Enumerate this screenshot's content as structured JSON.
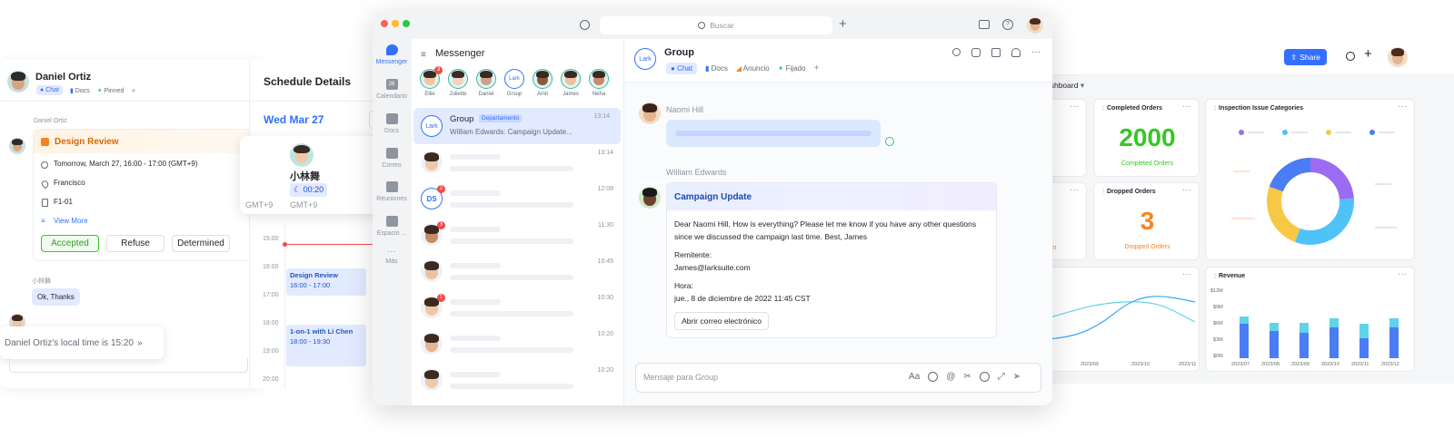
{
  "left_panel": {
    "user_name": "Daniel Ortiz",
    "tabs": [
      "Chat",
      "Docs",
      "Pinned"
    ],
    "plus": "+",
    "sender": "Daniel Ortiz",
    "event_title": "Design Review",
    "event_time": "Tomorrow, March 27, 16:00 - 17:00 (GMT+9)",
    "event_location": "Francisco",
    "event_room": "F1-01",
    "view_more": "View More",
    "rsvp": [
      "Accepted",
      "Refuse",
      "Determined"
    ],
    "reply_sender": "小林舞",
    "reply_text": "Ok, Thanks",
    "local_time": "Daniel Ortiz's local time is 15:20",
    "local_time_chevron": "»"
  },
  "schedule": {
    "title": "Schedule Details",
    "date": "Wed Mar 27",
    "popup_name": "小林舞",
    "popup_time": "00:20",
    "popup_tz": "GMT+9",
    "tz": "GMT+9",
    "hours": [
      "15:00",
      "16:00",
      "17:00",
      "18:00",
      "19:00",
      "20:00"
    ],
    "events": [
      {
        "title": "Design Review",
        "time": "16:00 - 17:00"
      },
      {
        "title": "1-on-1 with Li Chen",
        "time": "18:00 - 19:30"
      }
    ]
  },
  "window": {
    "search_placeholder": "Buscar",
    "plus": "+"
  },
  "rail": {
    "items": [
      "Messenger",
      "Calendario",
      "Docs",
      "Correo",
      "Reuniones",
      "Espacio ...",
      "Más"
    ],
    "calendar_day": "26"
  },
  "messenger": {
    "title": "Messenger",
    "stories": [
      {
        "name": "Ellie",
        "badge": "3",
        "color": "#f3c6a0"
      },
      {
        "name": "Juliette",
        "badge": "",
        "color": "#f1d2bd"
      },
      {
        "name": "Daniel",
        "badge": "",
        "color": "#c9a58b"
      },
      {
        "name": "Group",
        "badge": "",
        "color": "#3370ff",
        "logo": "Lark"
      },
      {
        "name": "Amit",
        "badge": "",
        "color": "#8a5a3c"
      },
      {
        "name": "James",
        "badge": "",
        "color": "#e8c3a3"
      },
      {
        "name": "Neha",
        "badge": "",
        "color": "#c98a6a"
      }
    ],
    "chats": [
      {
        "name": "Group",
        "tag": "Departamento",
        "preview": "William Edwards: Campaign Update...",
        "time": "13:14",
        "badge": "",
        "logo": "Lark"
      },
      {
        "name": "",
        "tag": "",
        "preview": "",
        "time": "13:14",
        "badge": "",
        "logo": ""
      },
      {
        "name": "",
        "tag": "",
        "preview": "",
        "time": "12:08",
        "badge": "2",
        "logo": "DS"
      },
      {
        "name": "",
        "tag": "",
        "preview": "",
        "time": "11:30",
        "badge": "3",
        "logo": ""
      },
      {
        "name": "",
        "tag": "",
        "preview": "",
        "time": "10:45",
        "badge": "",
        "logo": ""
      },
      {
        "name": "",
        "tag": "",
        "preview": "",
        "time": "10:30",
        "badge": "1",
        "logo": ""
      },
      {
        "name": "",
        "tag": "",
        "preview": "",
        "time": "10:20",
        "badge": "",
        "logo": ""
      },
      {
        "name": "",
        "tag": "",
        "preview": "",
        "time": "10:20",
        "badge": "",
        "logo": ""
      }
    ]
  },
  "conversation": {
    "title": "Group",
    "logo": "Lark",
    "tabs": [
      "Chat",
      "Docs",
      "Anuncio",
      "Fijado"
    ],
    "plus": "+",
    "msg1_sender": "Naomi Hill",
    "msg2_sender": "William Edwards",
    "card_title": "Campaign Update",
    "card_body": "Dear Naomi Hill, How is everything? Please let me know if you have any other questions since we discussed the campaign last time. Best, James",
    "remitente_label": "Remitente:",
    "remitente_value": "James@larksuite.com",
    "hora_label": "Hora:",
    "hora_value": "jue., 8 de diciembre de 2022 11:45 CST",
    "open_mail": "Abrir correo electrónico",
    "composer_placeholder": "Mensaje para Group"
  },
  "dashboard": {
    "share": "Share",
    "breadcrumb": "ashboard",
    "cards": [
      {
        "title": "Completed Orders",
        "value": "2000",
        "label": "Completed Orders",
        "color": "#34c724"
      },
      {
        "title": "Dropped Orders",
        "value": "3",
        "label": "Dropped Orders",
        "color": "#f5841f"
      },
      {
        "title": "Inspection Issue Categories"
      },
      {
        "title": "Revenue"
      }
    ],
    "partial_green_value": "0",
    "partial_green_label": "ers",
    "partial_orange_label": "tion",
    "line_dates": [
      "2023/09",
      "2023/10",
      "2023/11"
    ],
    "revenue_ylabels": [
      "$12M",
      "$9M",
      "$6M",
      "$3M",
      "$0M"
    ],
    "revenue_xlabels": [
      "2023/07",
      "2023/08",
      "2023/09",
      "2023/10",
      "2023/11",
      "2023/12"
    ]
  },
  "colors": {
    "accent": "#3370ff",
    "green": "#34c724",
    "orange": "#f5841f",
    "event_bg": "#e1eaff"
  }
}
